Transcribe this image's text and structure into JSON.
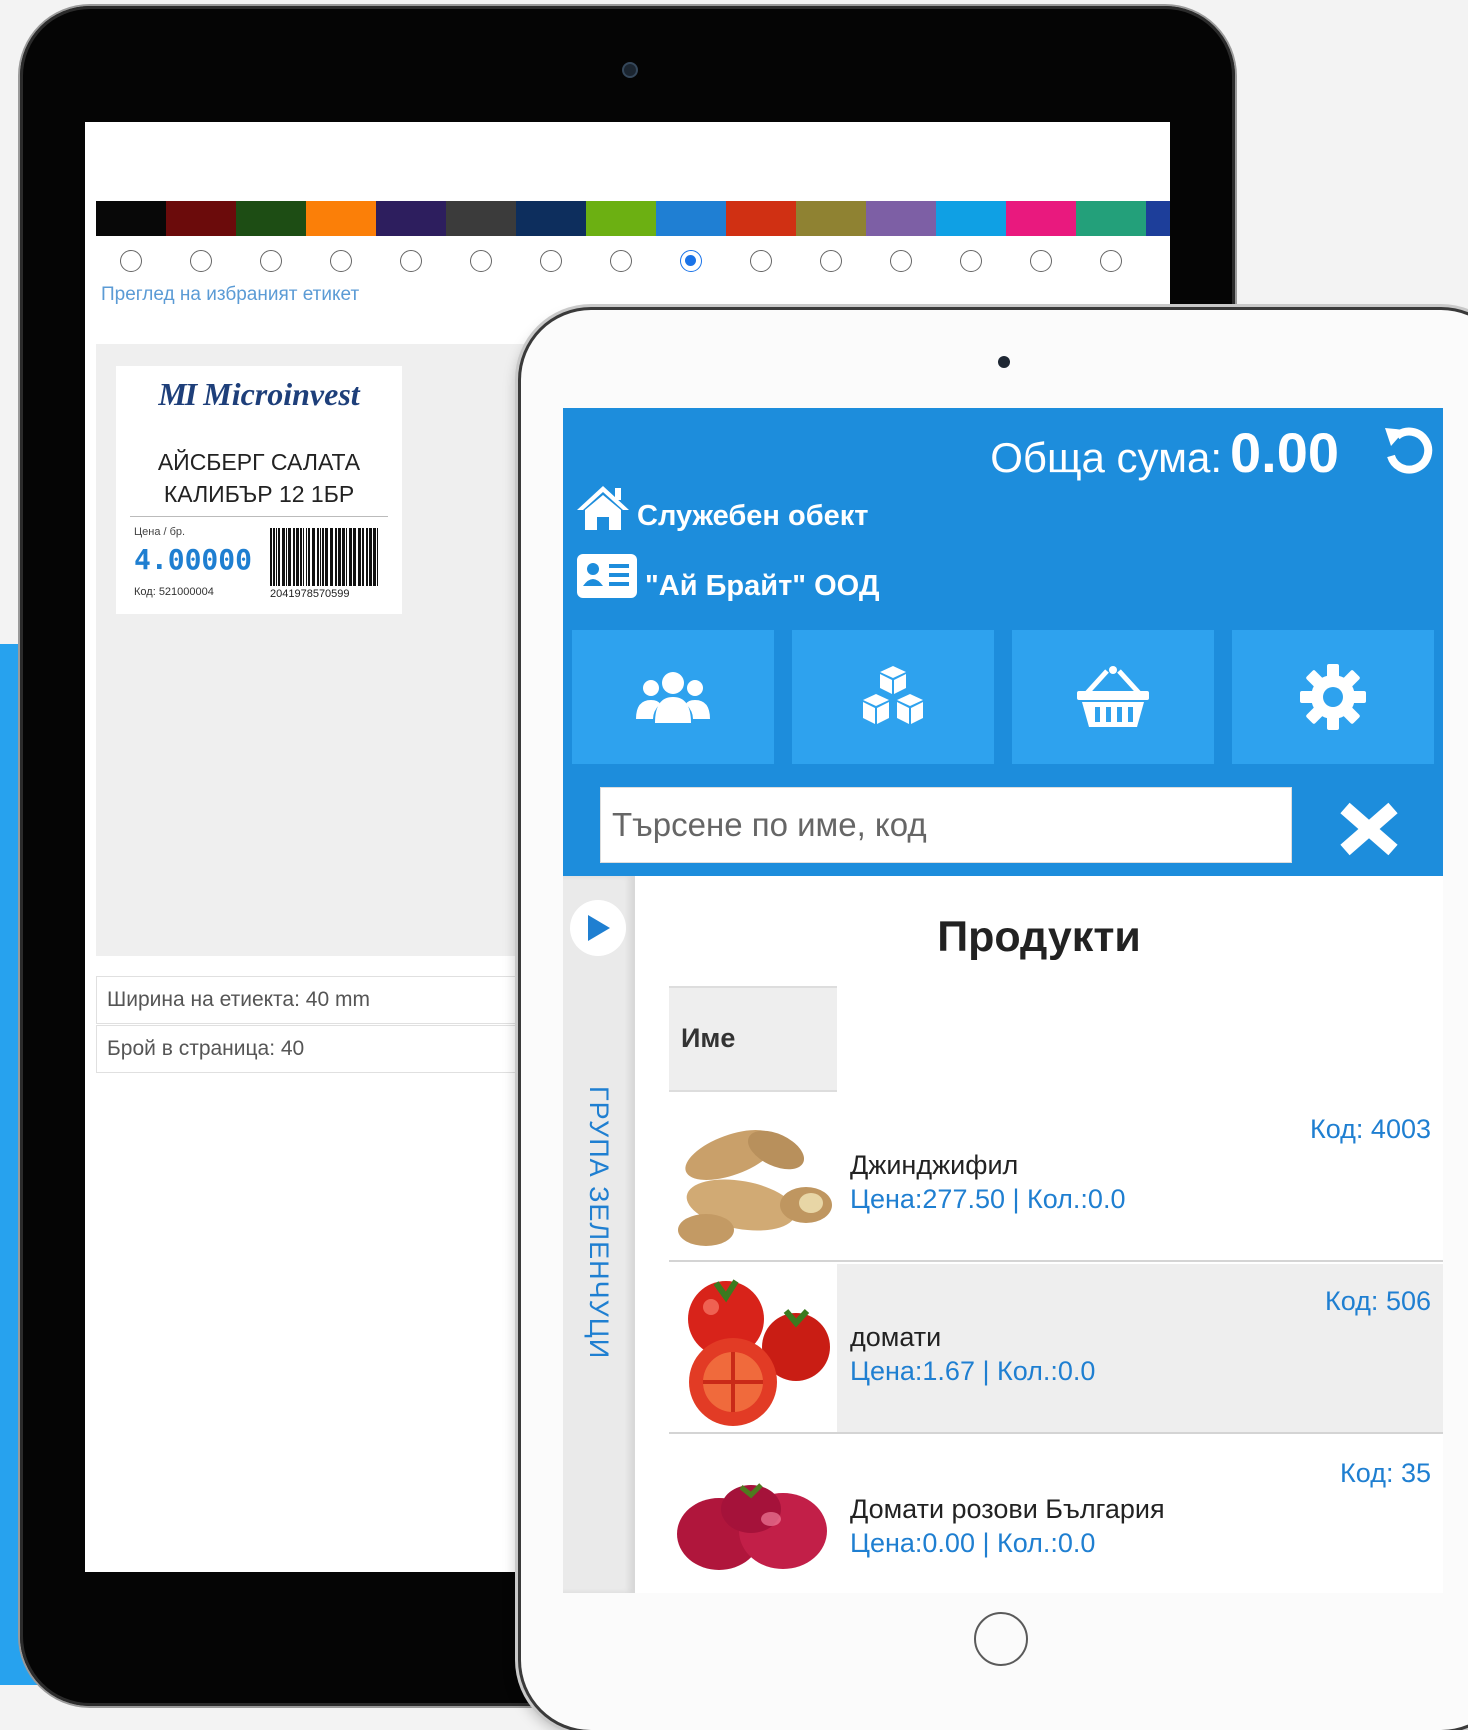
{
  "label_editor": {
    "swatches": [
      "#080808",
      "#6b0b0b",
      "#1d4d14",
      "#fb7f08",
      "#2d1e5e",
      "#3b3b3b",
      "#0d2e5d",
      "#6cb012",
      "#1f7fd3",
      "#d03013",
      "#8f8232",
      "#7d5fa5",
      "#0fa0e4",
      "#e9197e",
      "#23a07a",
      "#1d3e9a"
    ],
    "selected_swatch_index": 8,
    "preview_link": "Преглед на избраният етикет",
    "label": {
      "brand": "Microinvest",
      "brand_mark": "MI",
      "title_line1": "АЙСБЕРГ САЛАТА",
      "title_line2": "КАЛИБЪР 12 1БР",
      "price_caption": "Цена / бр.",
      "price": "4.00000",
      "code": "Код: 521000004",
      "barcode_number": "2041978570599"
    },
    "width_info": "Ширина на етиекта: 40 mm",
    "count_info": "Брой в страница: 40"
  },
  "pos": {
    "total_label": "Обща сума:",
    "total_value": "0.00",
    "site": "Служебен обект",
    "company": "\"Ай Брайт\" ООД",
    "tiles": [
      "users-icon",
      "boxes-icon",
      "basket-icon",
      "gear-icon"
    ],
    "search_placeholder": "Търсене по име, код",
    "group_label": "ГРУПА ЗЕЛЕНЧУЦИ",
    "products_title": "Продукти",
    "column_name": "Име",
    "products": [
      {
        "name": "Джинджифил",
        "meta": "Цена:277.50 | Кол.:0.0",
        "code": "Код: 4003"
      },
      {
        "name": "домати",
        "meta": "Цена:1.67 | Кол.:0.0",
        "code": "Код: 506"
      },
      {
        "name": "Домати розови България",
        "meta": "Цена:0.00 | Кол.:0.0",
        "code": "Код: 35"
      }
    ]
  },
  "colors": {
    "accent_blue": "#1d8ddc",
    "tile_blue": "#2ea2ee",
    "link_blue": "#1f7fd1"
  }
}
